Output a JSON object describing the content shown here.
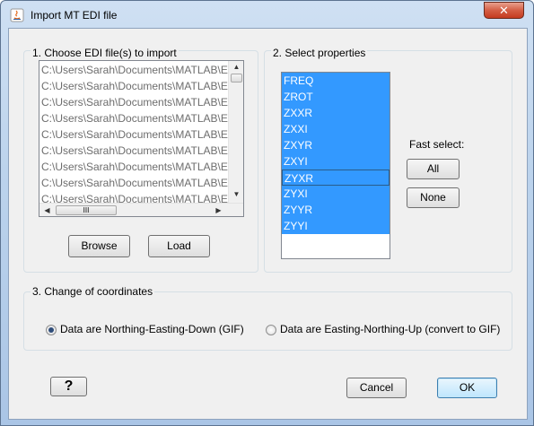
{
  "window": {
    "title": "Import MT EDI file",
    "close_label": "✕"
  },
  "files_group": {
    "label": "1. Choose EDI file(s) to import",
    "items": [
      "C:\\Users\\Sarah\\Documents\\MATLAB\\E",
      "C:\\Users\\Sarah\\Documents\\MATLAB\\E",
      "C:\\Users\\Sarah\\Documents\\MATLAB\\E",
      "C:\\Users\\Sarah\\Documents\\MATLAB\\E",
      "C:\\Users\\Sarah\\Documents\\MATLAB\\E",
      "C:\\Users\\Sarah\\Documents\\MATLAB\\E",
      "C:\\Users\\Sarah\\Documents\\MATLAB\\E",
      "C:\\Users\\Sarah\\Documents\\MATLAB\\E",
      "C:\\Users\\Sarah\\Documents\\MATLAB\\E"
    ],
    "browse_label": "Browse",
    "load_label": "Load",
    "hscroll_grip": "III"
  },
  "props_group": {
    "label": "2. Select properties",
    "items": [
      "FREQ",
      "ZROT",
      "ZXXR",
      "ZXXI",
      "ZXYR",
      "ZXYI",
      "ZYXR",
      "ZYXI",
      "ZYYR",
      "ZYYI"
    ],
    "fast_select_label": "Fast select:",
    "all_label": "All",
    "none_label": "None"
  },
  "coords_group": {
    "label": "3. Change of coordinates",
    "option1": "Data are Northing-Easting-Down (GIF)",
    "option2": "Data are Easting-Northing-Up (convert to GIF)",
    "selected": "option1"
  },
  "footer": {
    "help_label": "?",
    "cancel_label": "Cancel",
    "ok_label": "OK"
  }
}
